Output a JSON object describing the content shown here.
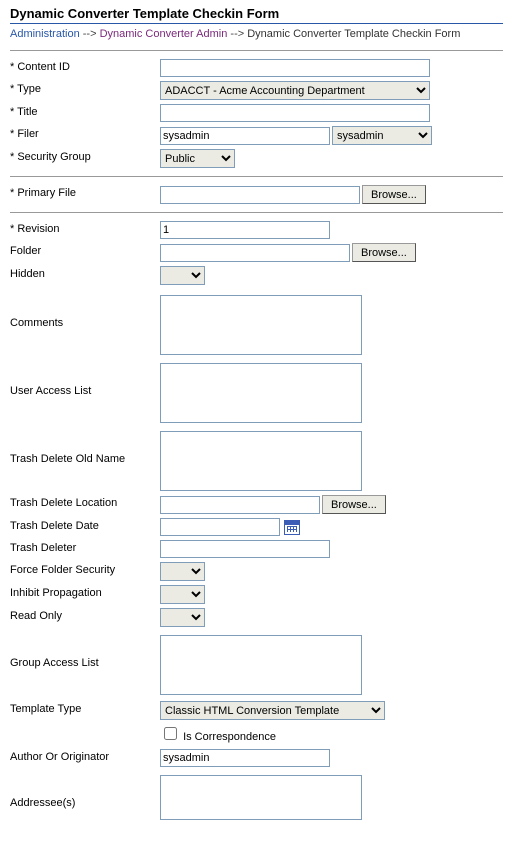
{
  "page_title": "Dynamic Converter Template Checkin Form",
  "breadcrumb": {
    "admin": "Administration",
    "sep": "-->",
    "dc_admin": "Dynamic Converter Admin",
    "current": "Dynamic Converter Template Checkin Form"
  },
  "labels": {
    "content_id": "* Content ID",
    "type": "* Type",
    "title": "* Title",
    "filer": "* Filer",
    "security_group": "* Security Group",
    "primary_file": "* Primary File",
    "revision": "* Revision",
    "folder": "Folder",
    "hidden": "Hidden",
    "comments": "Comments",
    "user_access_list": "User Access List",
    "trash_delete_old_name": "Trash Delete Old Name",
    "trash_delete_location": "Trash Delete Location",
    "trash_delete_date": "Trash Delete Date",
    "trash_deleter": "Trash Deleter",
    "force_folder_security": "Force Folder Security",
    "inhibit_propagation": "Inhibit Propagation",
    "read_only": "Read Only",
    "group_access_list": "Group Access List",
    "template_type": "Template Type",
    "is_correspondence": "Is Correspondence",
    "author_or_originator": "Author Or Originator",
    "addressee": "Addressee(s)"
  },
  "buttons": {
    "browse": "Browse..."
  },
  "values": {
    "content_id": "",
    "type_selected": "ADACCT - Acme Accounting Department",
    "title": "",
    "filer_text": "sysadmin",
    "filer_select": "sysadmin",
    "security_group": "Public",
    "primary_file": "",
    "revision": "1",
    "folder": "",
    "hidden": "",
    "comments": "",
    "user_access_list": "",
    "trash_delete_old_name": "",
    "trash_delete_location": "",
    "trash_delete_date": "",
    "trash_deleter": "",
    "force_folder_security": "",
    "inhibit_propagation": "",
    "read_only": "",
    "group_access_list": "",
    "template_type": "Classic HTML Conversion Template",
    "is_correspondence_checked": false,
    "author_or_originator": "sysadmin",
    "addressee": ""
  }
}
